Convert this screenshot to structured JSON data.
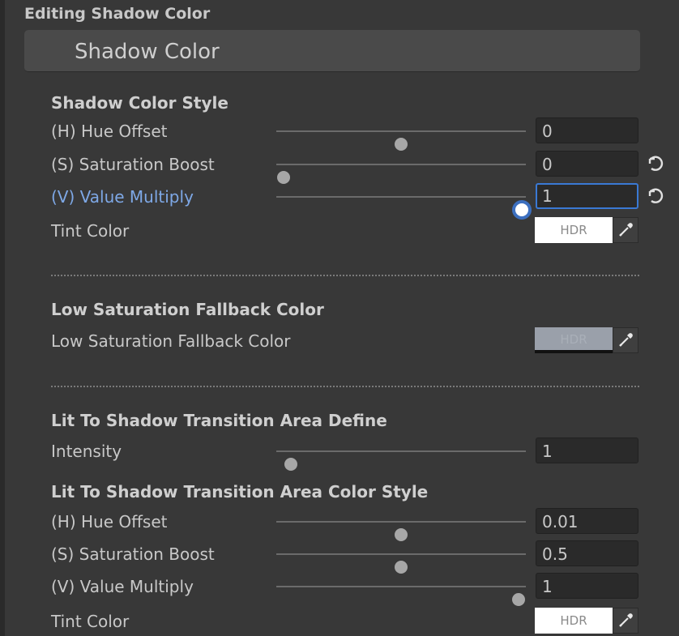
{
  "header": {
    "editing_label": "Editing Shadow Color"
  },
  "panel": {
    "title": "Shadow Color"
  },
  "shadow_color_style": {
    "title": "Shadow Color Style",
    "hue_offset": {
      "label": "(H) Hue Offset",
      "value": "0",
      "slider_fraction": 0.5
    },
    "saturation_boost": {
      "label": "(S) Saturation Boost",
      "value": "0",
      "slider_fraction": 0.03
    },
    "value_multiply": {
      "label": "(V) Value Multiply",
      "value": "1",
      "slider_fraction": 0.97
    },
    "tint_color": {
      "label": "Tint Color",
      "badge": "HDR",
      "color": "#ffffff"
    }
  },
  "low_saturation": {
    "title": "Low Saturation Fallback Color",
    "field": {
      "label": "Low Saturation Fallback Color",
      "badge": "HDR",
      "color": "#9aa0aa"
    }
  },
  "transition_define": {
    "title": "Lit To Shadow Transition Area Define",
    "intensity": {
      "label": "Intensity",
      "value": "1",
      "slider_fraction": 0.06
    }
  },
  "transition_color_style": {
    "title": "Lit To Shadow Transition Area Color Style",
    "hue_offset": {
      "label": "(H) Hue Offset",
      "value": "0.01",
      "slider_fraction": 0.5
    },
    "saturation_boost": {
      "label": "(S) Saturation Boost",
      "value": "0.5",
      "slider_fraction": 0.5
    },
    "value_multiply": {
      "label": "(V) Value Multiply",
      "value": "1",
      "slider_fraction": 0.97
    },
    "tint_color": {
      "label": "Tint Color",
      "badge": "HDR",
      "color": "#ffffff"
    }
  },
  "colors": {
    "background": "#383838",
    "accent": "#3a79d4",
    "active_label": "#7ea8e6"
  }
}
